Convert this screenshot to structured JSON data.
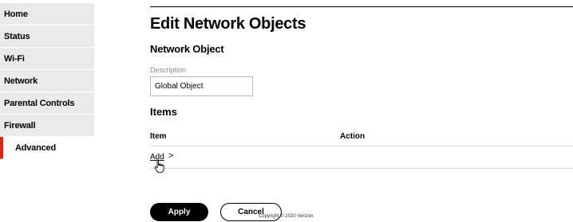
{
  "sidebar": {
    "items": [
      {
        "label": "Home"
      },
      {
        "label": "Status"
      },
      {
        "label": "Wi-Fi"
      },
      {
        "label": "Network"
      },
      {
        "label": "Parental Controls"
      },
      {
        "label": "Firewall"
      },
      {
        "label": "Advanced"
      }
    ],
    "active_accent": "#d52b1e"
  },
  "main": {
    "title": "Edit Network Objects",
    "section_title": "Network Object",
    "description": {
      "label": "Description",
      "value": "Global Object"
    },
    "items_title": "Items",
    "table": {
      "headers": {
        "item": "Item",
        "action": "Action"
      },
      "add_link": "Add",
      "add_chevron": ">"
    },
    "buttons": {
      "apply": "Apply",
      "cancel": "Cancel"
    }
  },
  "footer": {
    "copyright": "Copyright © 2020 Verizon."
  }
}
